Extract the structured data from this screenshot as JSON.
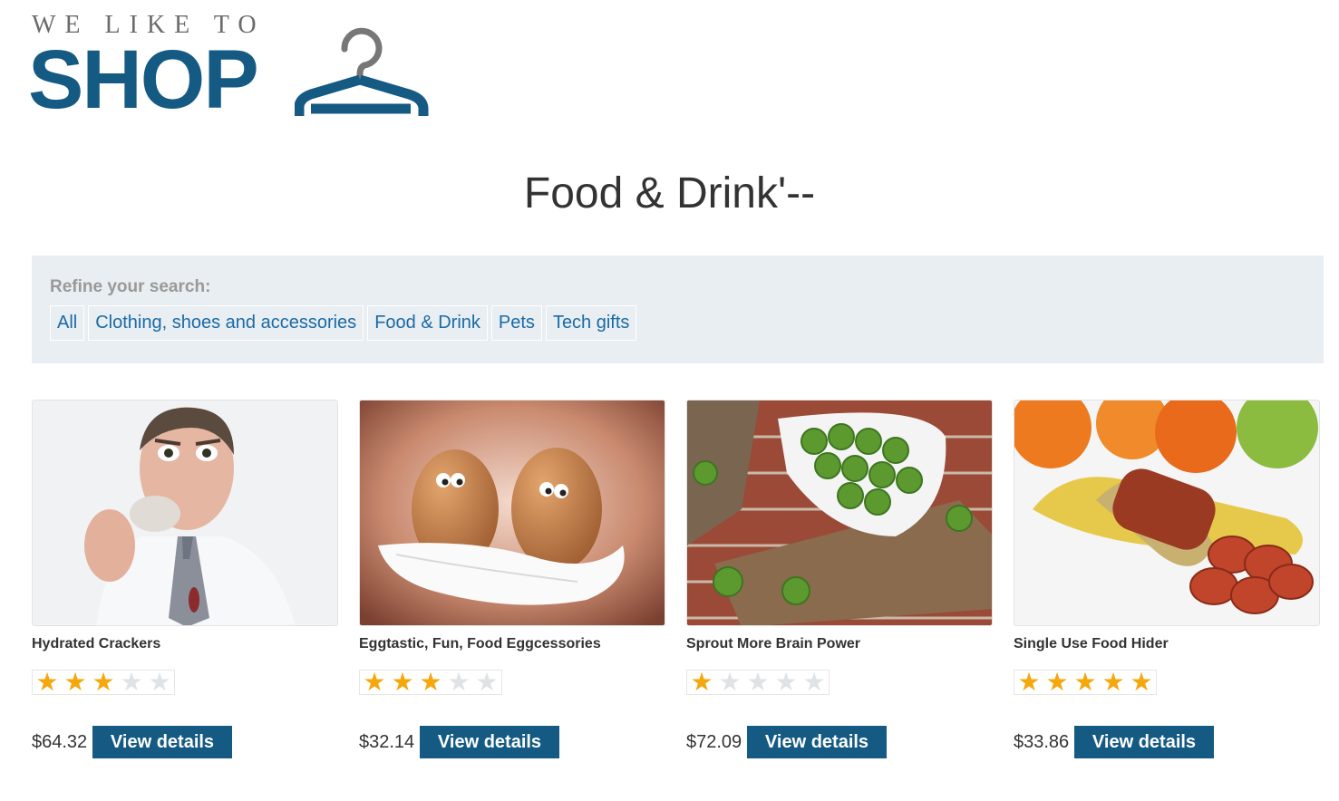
{
  "brand": {
    "tagline": "WE LIKE TO",
    "name": "SHOP",
    "color": "#145a83"
  },
  "page_title": "Food & Drink'--",
  "filter": {
    "label": "Refine your search:",
    "links": [
      "All",
      "Clothing, shoes and accessories",
      "Food & Drink",
      "Pets",
      "Tech gifts"
    ]
  },
  "products": [
    {
      "name": "Hydrated Crackers",
      "rating": 3,
      "price": "$64.32",
      "button": "View details",
      "image": "man-eating-cracker-photo"
    },
    {
      "name": "Eggtastic, Fun, Food Eggcessories",
      "rating": 3,
      "price": "$32.14",
      "button": "View details",
      "image": "cartoon-eggs-photo"
    },
    {
      "name": "Sprout More Brain Power",
      "rating": 1,
      "price": "$72.09",
      "button": "View details",
      "image": "brussels-sprouts-photo"
    },
    {
      "name": "Single Use Food Hider",
      "rating": 5,
      "price": "$33.86",
      "button": "View details",
      "image": "sausage-in-banana-photo"
    }
  ],
  "colors": {
    "star_on": "#f5a70c",
    "star_off": "#dfe3e6",
    "link": "#1a6aa8",
    "filter_bg": "#e8eef1"
  }
}
